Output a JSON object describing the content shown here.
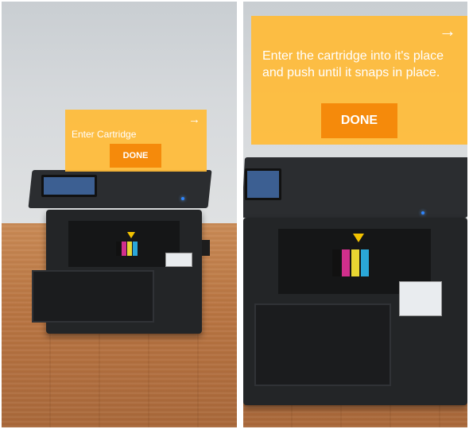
{
  "left_screen": {
    "instruction": "Enter Cartridge",
    "next_icon": "→",
    "done_label": "DONE"
  },
  "right_screen": {
    "instruction": "Enter the cartridge into it's place and push until it snaps in place.",
    "next_icon": "→",
    "done_label": "DONE"
  },
  "colors": {
    "card": "#ffbb38",
    "button": "#f58a0b",
    "text": "#ffffff"
  }
}
